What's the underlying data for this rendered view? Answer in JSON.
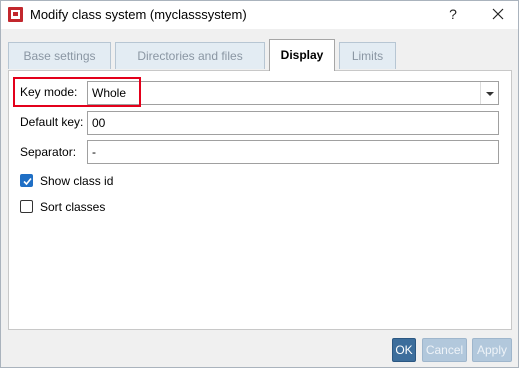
{
  "window": {
    "title": "Modify class system (myclasssystem)",
    "help_label": "?",
    "icon": "app-icon"
  },
  "tabs": [
    {
      "label": "Base settings",
      "active": false
    },
    {
      "label": "Directories and files",
      "active": false
    },
    {
      "label": "Display",
      "active": true
    },
    {
      "label": "Limits",
      "active": false
    }
  ],
  "form": {
    "key_mode": {
      "label": "Key mode:",
      "value": "Whole"
    },
    "default_key": {
      "label": "Default key:",
      "value": "00"
    },
    "separator": {
      "label": "Separator:",
      "value": "-"
    },
    "show_class_id": {
      "label": "Show class id",
      "checked": true
    },
    "sort_classes": {
      "label": "Sort classes",
      "checked": false
    }
  },
  "buttons": {
    "ok": "OK",
    "cancel": "Cancel",
    "apply": "Apply"
  },
  "colors": {
    "highlight": "#e3001b",
    "accent": "#1f6fc5",
    "ok_button": "#3d6e9c"
  }
}
